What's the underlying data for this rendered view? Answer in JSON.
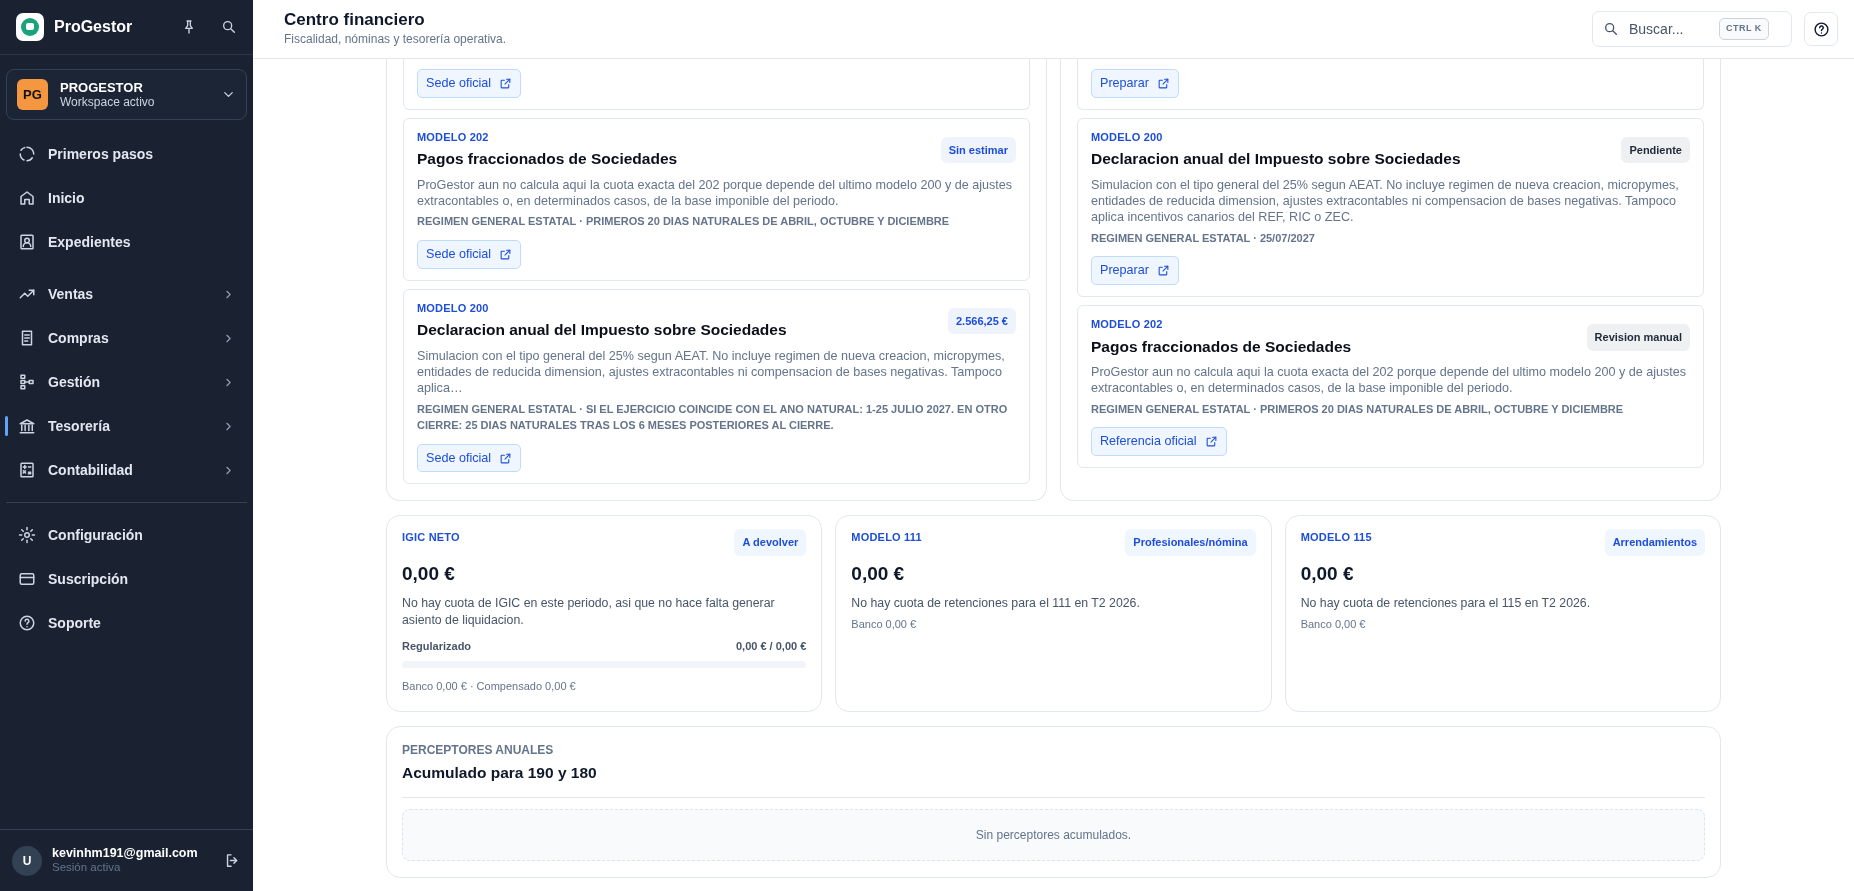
{
  "sidebar": {
    "brand": "ProGestor",
    "workspace": {
      "initials": "PG",
      "name": "PROGESTOR",
      "subtitle": "Workspace activo"
    },
    "groups": [
      {
        "items": [
          {
            "label": "Primeros pasos",
            "kind": "plain",
            "selected": false
          },
          {
            "label": "Inicio",
            "kind": "plain",
            "selected": false
          },
          {
            "label": "Expedientes",
            "kind": "plain",
            "selected": false
          }
        ]
      },
      {
        "items": [
          {
            "label": "Ventas",
            "kind": "expandable",
            "selected": false
          },
          {
            "label": "Compras",
            "kind": "expandable",
            "selected": false
          },
          {
            "label": "Gestión",
            "kind": "expandable",
            "selected": false
          },
          {
            "label": "Tesorería",
            "kind": "expandable",
            "selected": true
          },
          {
            "label": "Contabilidad",
            "kind": "expandable",
            "selected": false
          }
        ]
      },
      {
        "items": [
          {
            "label": "Configuración",
            "kind": "plain",
            "selected": false
          },
          {
            "label": "Suscripción",
            "kind": "plain",
            "selected": false
          },
          {
            "label": "Soporte",
            "kind": "plain",
            "selected": false
          }
        ]
      }
    ],
    "user": {
      "initial": "U",
      "email": "kevinhm191@gmail.com",
      "status": "Sesión activa"
    }
  },
  "header": {
    "title": "Centro financiero",
    "subtitle": "Fiscalidad, nóminas y tesorería operativa.",
    "search": {
      "placeholder": "Buscar...",
      "shortcut": "CTRL K"
    }
  },
  "columns": [
    {
      "cards": [
        {
          "kind": "partial",
          "button": "Sede oficial"
        },
        {
          "kind": "full",
          "model": "MODELO 202",
          "title": "Pagos fraccionados de Sociedades",
          "badge": {
            "text": "Sin estimar",
            "color": "#1d4ed8"
          },
          "description": "ProGestor aun no calcula aqui la cuota exacta del 202 porque depende del ultimo modelo 200 y de ajustes extracontables o, en determinados casos, de la base imponible del periodo.",
          "meta": "REGIMEN GENERAL ESTATAL · PRIMEROS 20 DIAS NATURALES DE ABRIL, OCTUBRE Y DICIEMBRE",
          "button": "Sede oficial"
        },
        {
          "kind": "full",
          "model": "MODELO 200",
          "title": "Declaracion anual del Impuesto sobre Sociedades",
          "badge": {
            "text": "2.566,25 €",
            "color": "#1d4ed8"
          },
          "description": "Simulacion con el tipo general del 25% segun AEAT. No incluye regimen de nueva creacion, micropymes, entidades de reducida dimension, ajustes extracontables ni compensacion de bases negativas. Tampoco aplica…",
          "meta": "REGIMEN GENERAL ESTATAL · SI EL EJERCICIO COINCIDE CON EL ANO NATURAL: 1-25 JULIO 2027. EN OTRO CIERRE: 25 DIAS NATURALES TRAS LOS 6 MESES POSTERIORES AL CIERRE.",
          "button": "Sede oficial"
        }
      ]
    },
    {
      "cards": [
        {
          "kind": "partial",
          "button": "Preparar"
        },
        {
          "kind": "full",
          "model": "MODELO 200",
          "title": "Declaracion anual del Impuesto sobre Sociedades",
          "badge": {
            "text": "Pendiente",
            "color": "#1e293b"
          },
          "description": "Simulacion con el tipo general del 25% segun AEAT. No incluye regimen de nueva creacion, micropymes, entidades de reducida dimension, ajustes extracontables ni compensacion de bases negativas. Tampoco aplica incentivos canarios del REF, RIC o ZEC.",
          "meta": "REGIMEN GENERAL ESTATAL · 25/07/2027",
          "button": "Preparar"
        },
        {
          "kind": "full",
          "model": "MODELO 202",
          "title": "Pagos fraccionados de Sociedades",
          "badge": {
            "text": "Revision manual",
            "color": "#1e293b"
          },
          "description": "ProGestor aun no calcula aqui la cuota exacta del 202 porque depende del ultimo modelo 200 y de ajustes extracontables o, en determinados casos, de la base imponible del periodo.",
          "meta": "REGIMEN GENERAL ESTATAL · PRIMEROS 20 DIAS NATURALES DE ABRIL, OCTUBRE Y DICIEMBRE",
          "button": "Referencia oficial"
        }
      ]
    }
  ],
  "metrics": [
    {
      "model": "IGIC NETO",
      "badge": "A devolver",
      "amount": "0,00 €",
      "description": "No hay cuota de IGIC en este periodo, asi que no hace falta generar asiento de liquidacion.",
      "progress": {
        "label": "Regularizado",
        "value": "0,00 € / 0,00 €",
        "level": 0
      },
      "footer": "Banco 0,00 € · Compensado 0,00 €"
    },
    {
      "model": "MODELO 111",
      "badge": "Profesionales/nómina",
      "amount": "0,00 €",
      "description": "No hay cuota de retenciones para el 111 en T2 2026.",
      "footer": "Banco 0,00 €"
    },
    {
      "model": "MODELO 115",
      "badge": "Arrendamientos",
      "amount": "0,00 €",
      "description": "No hay cuota de retenciones para el 115 en T2 2026.",
      "footer": "Banco 0,00 €"
    }
  ],
  "perceptores": {
    "eyebrow": "PERCEPTORES ANUALES",
    "title": "Acumulado para 190 y 180",
    "empty": "Sin perceptores acumulados."
  }
}
